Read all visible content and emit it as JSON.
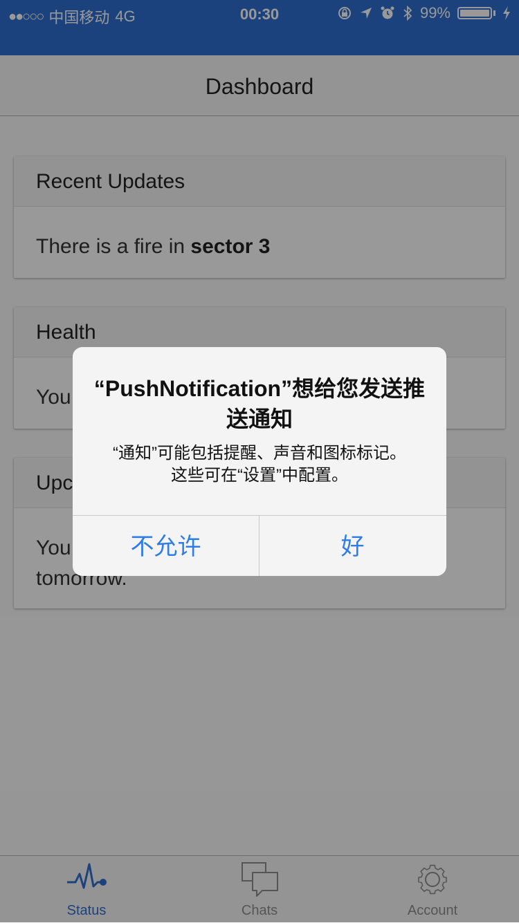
{
  "status_bar": {
    "signal": "●●○○○",
    "carrier": "中国移动",
    "network": "4G",
    "time": "00:30",
    "icons": [
      "orientation-lock-icon",
      "location-icon",
      "alarm-icon",
      "bluetooth-icon",
      "charging-icon"
    ],
    "battery": "99%",
    "battery_level": 0.99
  },
  "nav": {
    "title": "Dashboard"
  },
  "cards": [
    {
      "title": "Recent Updates",
      "body_prefix": "There is a fire in ",
      "body_strong": "sector 3"
    },
    {
      "title": "Health",
      "body": "You"
    },
    {
      "title": "Upc",
      "body_line1": "You",
      "body_line2": "tomorrow."
    }
  ],
  "tabs": [
    {
      "label": "Status",
      "icon": "pulse-icon",
      "active": true
    },
    {
      "label": "Chats",
      "icon": "chat-bubbles-icon",
      "active": false
    },
    {
      "label": "Account",
      "icon": "gear-icon",
      "active": false
    }
  ],
  "alert": {
    "title": "“PushNotification”想给您发送推送通知",
    "message_line1": "“通知”可能包括提醒、声音和图标标记。",
    "message_line2": "这些可在“设置”中配置。",
    "deny_label": "不允许",
    "allow_label": "好"
  },
  "colors": {
    "accent": "#2e6fd0",
    "button_text": "#2e7ce6",
    "overlay": "rgba(0,0,0,0.40)"
  }
}
